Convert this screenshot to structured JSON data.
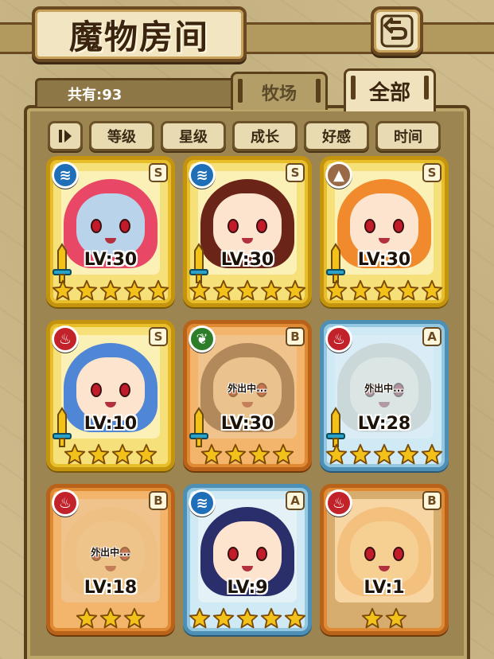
{
  "header": {
    "title": "魔物房间"
  },
  "summary": {
    "count_label": "共有:93"
  },
  "tabs": [
    {
      "label": "牧场",
      "active": false
    },
    {
      "label": "全部",
      "active": true
    }
  ],
  "sort": {
    "toggle_icon": "sort-toggle-icon",
    "buttons": [
      "等级",
      "星级",
      "成长",
      "好感",
      "时间"
    ]
  },
  "colors": {
    "gold_frame": "#c4940f",
    "orange_frame": "#b8621a",
    "blue_frame": "#4d8fb5",
    "star": "#f2c21b"
  },
  "monsters": [
    {
      "element": "water",
      "rank": "S",
      "level": "LV:30",
      "stars": 5,
      "frame": "gold",
      "away": "",
      "hair": "#e84866",
      "skin": "#b9d3ea"
    },
    {
      "element": "water",
      "rank": "S",
      "level": "LV:30",
      "stars": 5,
      "frame": "gold",
      "away": "",
      "hair": "#6b2418",
      "skin": "#fde4cf"
    },
    {
      "element": "earth",
      "rank": "S",
      "level": "LV:30",
      "stars": 5,
      "frame": "gold",
      "away": "",
      "hair": "#f08a2c",
      "skin": "#fde4cf"
    },
    {
      "element": "fire",
      "rank": "S",
      "level": "LV:10",
      "stars": 4,
      "frame": "gold",
      "away": "",
      "hair": "#4f86d6",
      "skin": "#fde4cf"
    },
    {
      "element": "wood",
      "rank": "B",
      "level": "LV:30",
      "stars": 4,
      "frame": "orange",
      "away": "外出中...",
      "hair": "#6a5640",
      "skin": "#e8d2a8"
    },
    {
      "element": "fire",
      "rank": "A",
      "level": "LV:28",
      "stars": 5,
      "frame": "blue",
      "away": "外出中...",
      "hair": "#c9c4b2",
      "skin": "#efe2c8"
    },
    {
      "element": "fire",
      "rank": "B",
      "level": "LV:18",
      "stars": 3,
      "frame": "orange",
      "away": "外出中...",
      "hair": "#f5cf86",
      "skin": "#f5d99a"
    },
    {
      "element": "water",
      "rank": "A",
      "level": "LV:9",
      "stars": 5,
      "frame": "blue",
      "away": "",
      "hair": "#2a2f6b",
      "skin": "#fde4cf"
    },
    {
      "element": "fire",
      "rank": "B",
      "level": "LV:1",
      "stars": 2,
      "frame": "orange-plain",
      "away": "",
      "hair": "#f3c07d",
      "skin": "#f6cf93"
    }
  ]
}
